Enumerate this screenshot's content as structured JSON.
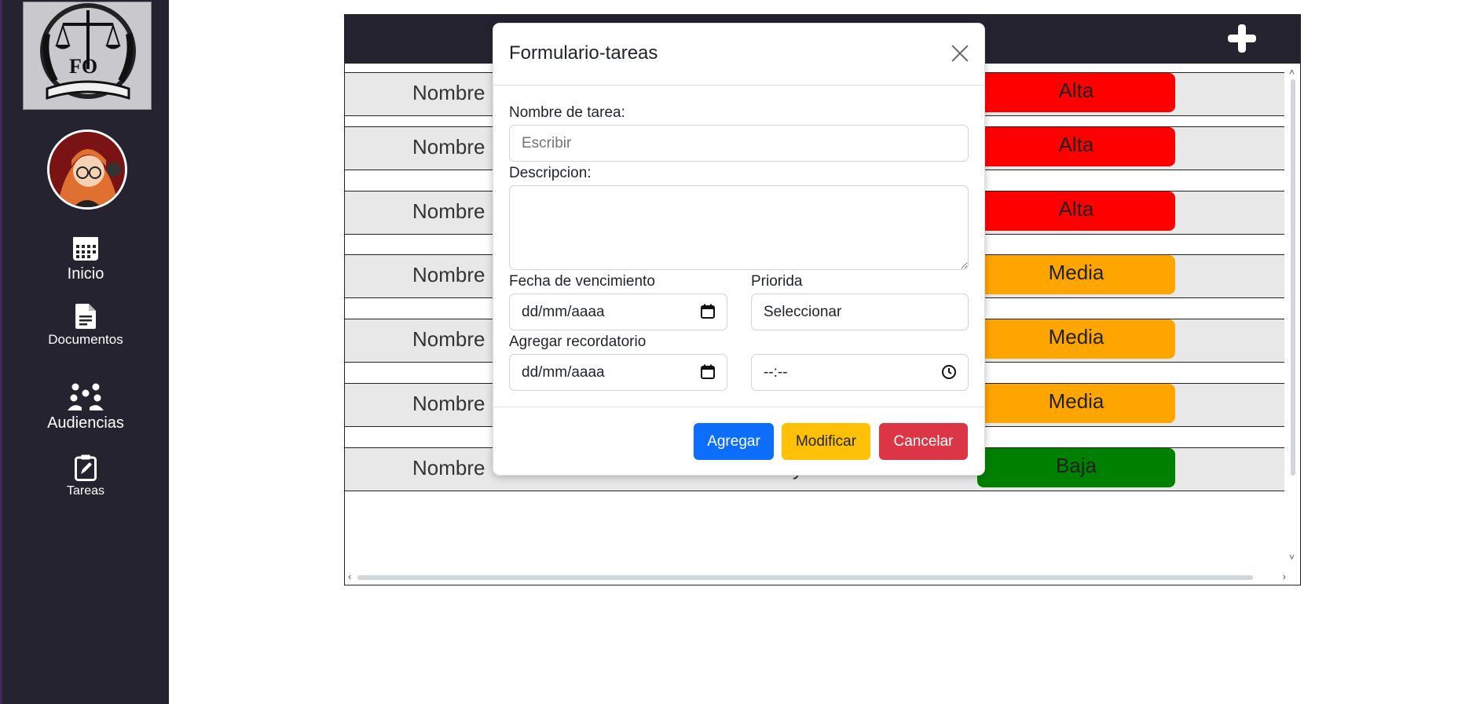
{
  "sidebar": {
    "nav": [
      {
        "label": "Inicio",
        "icon": "calendar-icon"
      },
      {
        "label": "Documentos",
        "icon": "document-icon"
      },
      {
        "label": "Audiencias",
        "icon": "group-icon"
      },
      {
        "label": "Tareas",
        "icon": "clipboard-edit-icon"
      }
    ]
  },
  "tasks": [
    {
      "name": "Nombre",
      "priority": "Alta",
      "color": "#ff0000"
    },
    {
      "name": "Nombre",
      "priority": "Alta",
      "color": "#ff0000"
    },
    {
      "name": "Nombre",
      "priority": "Alta",
      "color": "#ff0000"
    },
    {
      "name": "Nombre",
      "priority": "Media",
      "color": "#ffa500"
    },
    {
      "name": "Nombre",
      "priority": "Media",
      "color": "#ffa500"
    },
    {
      "name": "Nombre",
      "priority": "Media",
      "color": "#ffa500"
    },
    {
      "name": "Nombre",
      "priority": "Baja",
      "color": "#008000",
      "partial_text": "y"
    }
  ],
  "modal": {
    "title": "Formulario-tareas",
    "name_label": "Nombre de tarea:",
    "name_placeholder": "Escribir",
    "description_label": "Descripcion:",
    "due_label": "Fecha de vencimiento",
    "due_value": "dd/mm/aaaa",
    "priority_label": "Priorida",
    "priority_value": "Seleccionar",
    "reminder_label": "Agregar recordatorio",
    "reminder_date": "dd/mm/aaaa",
    "reminder_time": "--:--",
    "buttons": {
      "add": "Agregar",
      "modify": "Modificar",
      "cancel": "Cancelar"
    }
  },
  "colors": {
    "sidebar": "#25232f",
    "add_button": "#0d6efd",
    "modify_button": "#ffc107",
    "cancel_button": "#dc3545"
  }
}
